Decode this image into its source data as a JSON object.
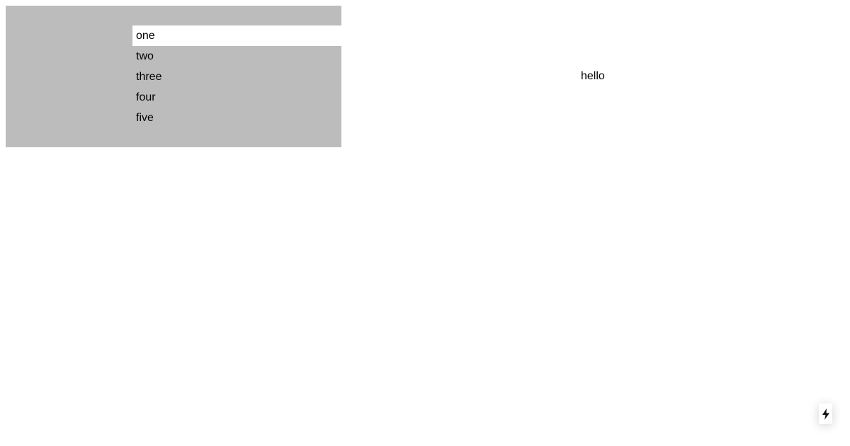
{
  "list": {
    "items": [
      {
        "label": "one",
        "selected": true
      },
      {
        "label": "two",
        "selected": false
      },
      {
        "label": "three",
        "selected": false
      },
      {
        "label": "four",
        "selected": false
      },
      {
        "label": "five",
        "selected": false
      }
    ]
  },
  "content": {
    "text": "hello"
  },
  "fab": {
    "icon": "lightning-bolt-icon"
  },
  "colors": {
    "panel_background": "#bcbcbc",
    "selected_background": "#ffffff",
    "text": "#000000"
  }
}
